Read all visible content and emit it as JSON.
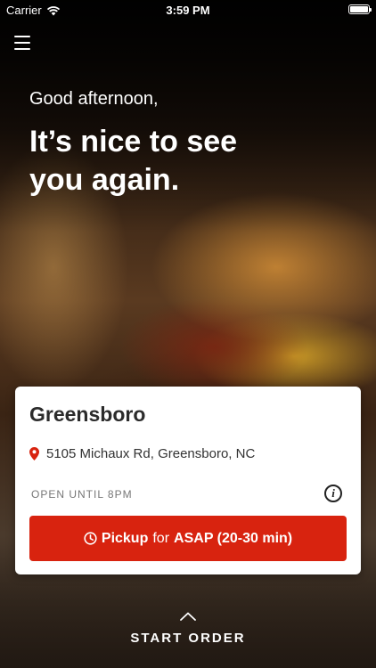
{
  "status_bar": {
    "carrier": "Carrier",
    "time": "3:59 PM",
    "icons": [
      "wifi-icon",
      "battery-icon"
    ]
  },
  "header": {
    "menu_icon": "hamburger-menu-icon"
  },
  "hero": {
    "greeting": "Good afternoon,",
    "headline": "It’s nice to see you again."
  },
  "location_card": {
    "name": "Greensboro",
    "address": "5105 Michaux Rd, Greensboro, NC",
    "hours": "OPEN UNTIL 8PM",
    "pickup_button": {
      "mode": "Pickup",
      "connector": "for",
      "time": "ASAP (20-30 min)"
    }
  },
  "footer": {
    "start_order_label": "START ORDER"
  },
  "colors": {
    "accent": "#d8230f",
    "card_background": "#ffffff",
    "text_dark": "#2b2b2b",
    "text_muted": "#777777"
  }
}
